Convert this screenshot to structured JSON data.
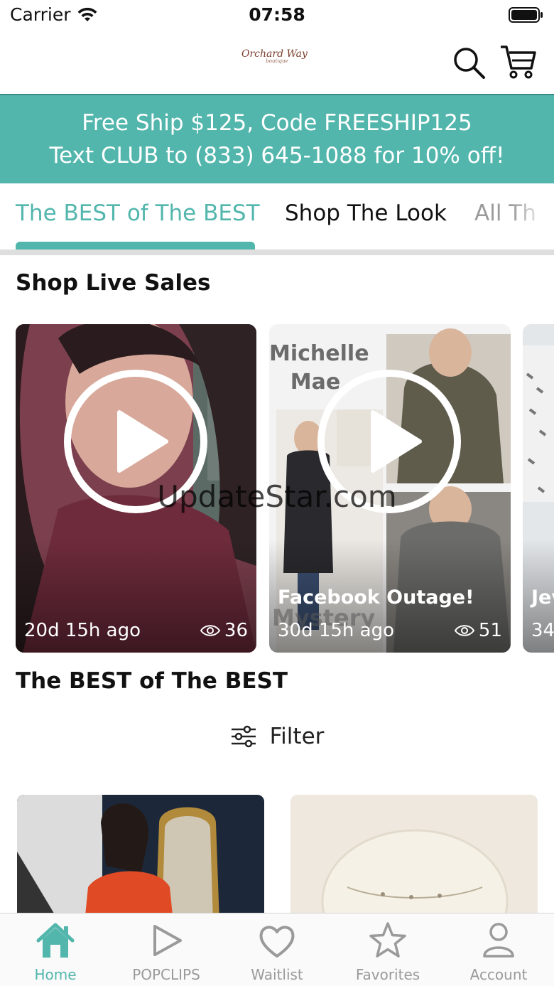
{
  "status_bar": {
    "carrier": "Carrier",
    "time": "07:58"
  },
  "header": {
    "logo_text": "Orchard Way",
    "logo_subtext": "boutique",
    "icons": [
      "search-icon",
      "cart-icon"
    ]
  },
  "promo": {
    "line1": "Free Ship $125, Code FREESHIP125",
    "line2": "Text CLUB to (833) 645-1088 for 10% off!"
  },
  "tabs": [
    {
      "label": "The BEST of The BEST",
      "active": true
    },
    {
      "label": "Shop The Look",
      "active": false
    },
    {
      "label": "All Th",
      "active": false
    }
  ],
  "live_sales": {
    "title": "Shop Live Sales",
    "cards": [
      {
        "title": "",
        "ago": "20d 15h ago",
        "views": "36"
      },
      {
        "title": "Facebook Outage!",
        "overlay_name_line1": "Michelle",
        "overlay_name_line2": "Mae",
        "overlay_bottom": "Mystery",
        "ago": "30d 15h ago",
        "views": "51"
      },
      {
        "title": "Jev",
        "ago": "34",
        "views": ""
      }
    ]
  },
  "best_section": {
    "title": "The BEST of The BEST",
    "filter_label": "Filter"
  },
  "watermark": "UpdateStar.com",
  "tabbar": [
    {
      "label": "Home",
      "icon": "home-icon",
      "active": true
    },
    {
      "label": "POPCLIPS",
      "icon": "play-icon",
      "active": false
    },
    {
      "label": "Waitlist",
      "icon": "heart-icon",
      "active": false
    },
    {
      "label": "Favorites",
      "icon": "star-icon",
      "active": false
    },
    {
      "label": "Account",
      "icon": "person-icon",
      "active": false
    }
  ],
  "colors": {
    "accent": "#52b6ad",
    "header_rule": "#3a8c88",
    "tab_inactive": "#9a9a9a"
  }
}
